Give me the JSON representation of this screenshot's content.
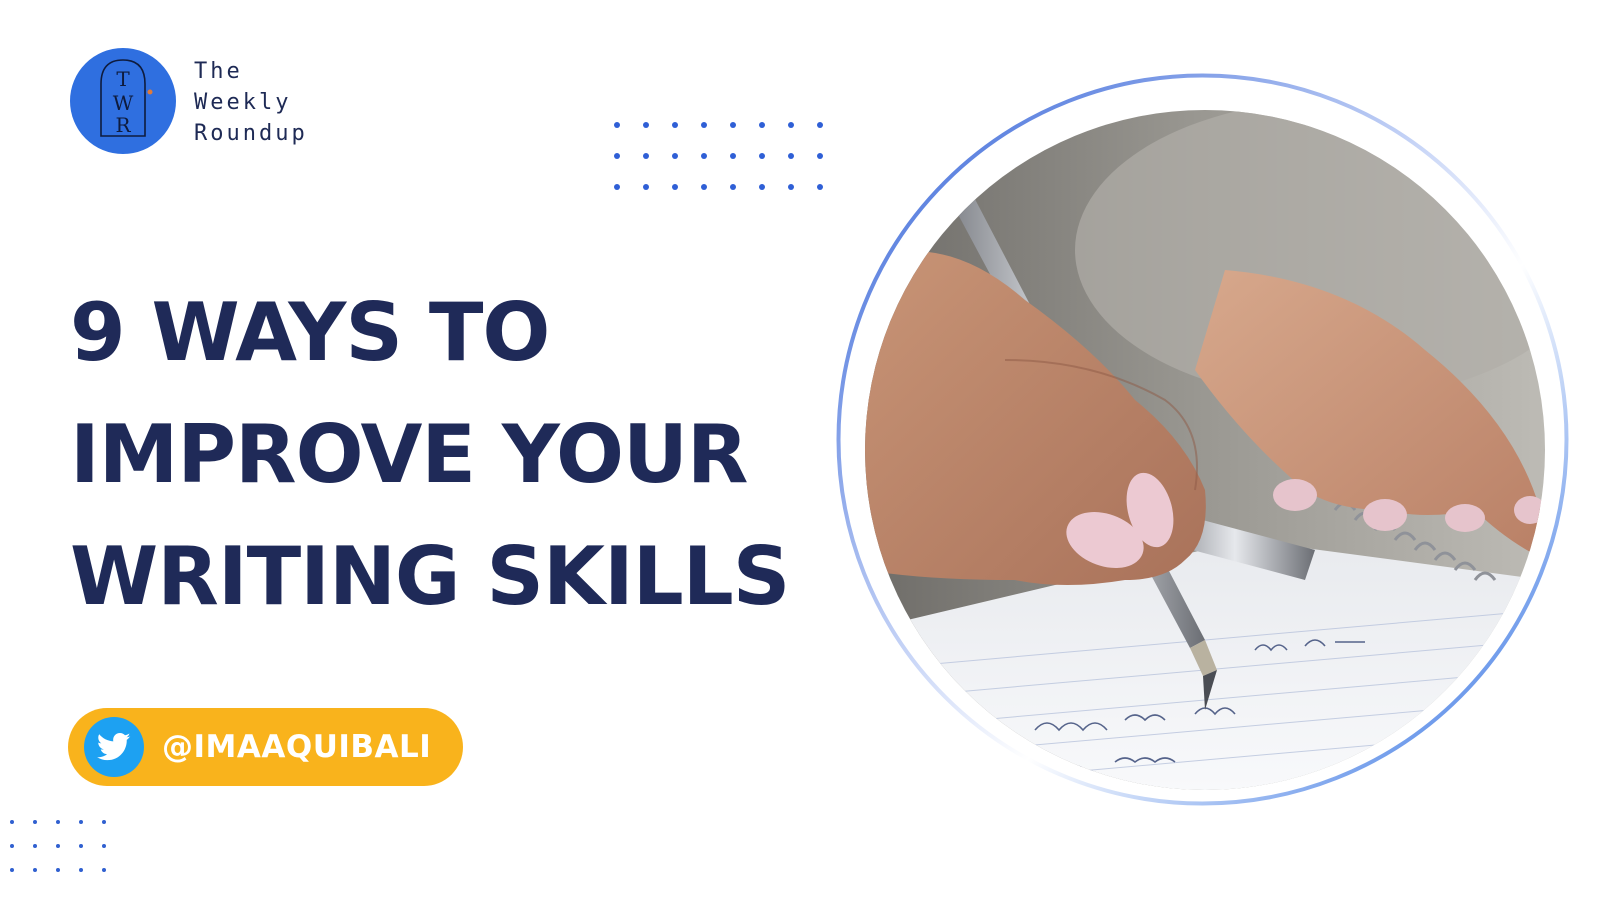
{
  "brand": {
    "monogram": "TWR",
    "name_lines": [
      "The",
      "Weekly",
      "Roundup"
    ],
    "color": "#2f6fe0"
  },
  "headline": {
    "lines": [
      "9 WAYS TO",
      "IMPROVE YOUR",
      "WRITING SKILLS"
    ],
    "color": "#1f2a58"
  },
  "social": {
    "platform_icon": "twitter-bird-icon",
    "handle": "@IMAAQUIBALI",
    "pill_color": "#f9b31c",
    "icon_color": "#1da1f2"
  },
  "photo": {
    "subject": "hand-writing-with-fountain-pen",
    "notebook_text": [
      "- LUNCH -",
      "Vent Sarah Office"
    ]
  },
  "accent": "#2f5fd6"
}
